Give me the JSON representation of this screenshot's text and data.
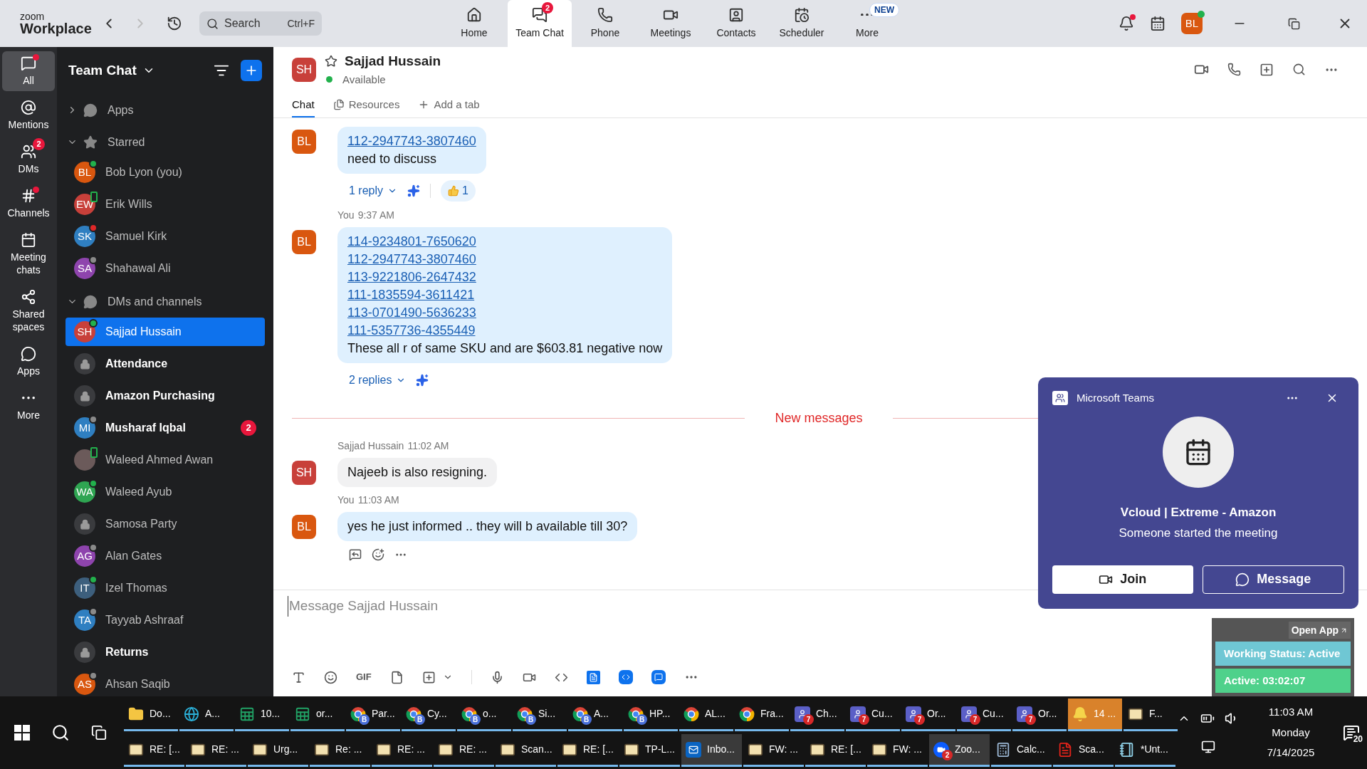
{
  "topbar": {
    "logo_small": "zoom",
    "logo": "Workplace",
    "search": {
      "placeholder": "Search",
      "shortcut": "Ctrl+F"
    },
    "nav": [
      {
        "kind": "home",
        "label": "Home",
        "selected": false
      },
      {
        "kind": "chat",
        "label": "Team Chat",
        "selected": true,
        "badge": "2"
      },
      {
        "kind": "phone",
        "label": "Phone",
        "selected": false
      },
      {
        "kind": "meetings",
        "label": "Meetings",
        "selected": false
      },
      {
        "kind": "contacts",
        "label": "Contacts",
        "selected": false
      },
      {
        "kind": "scheduler",
        "label": "Scheduler",
        "selected": false
      },
      {
        "kind": "more",
        "label": "More",
        "selected": false,
        "tag": "NEW"
      }
    ],
    "avatar": {
      "initials": "BL",
      "color": "#d9570f"
    }
  },
  "rail": [
    {
      "kind": "all",
      "label": "All",
      "selected": true,
      "dot": true
    },
    {
      "kind": "mentions",
      "label": "Mentions",
      "selected": false,
      "dot": false
    },
    {
      "kind": "dms",
      "label": "DMs",
      "selected": false,
      "dot": false,
      "badge": "2"
    },
    {
      "kind": "channels",
      "label": "Channels",
      "selected": false,
      "dot": true
    },
    {
      "kind": "meetings",
      "label": "Meeting chats",
      "selected": false,
      "dot": false
    },
    {
      "kind": "spaces",
      "label": "Shared spaces",
      "selected": false,
      "dot": false
    },
    {
      "kind": "apps",
      "label": "Apps",
      "selected": false,
      "dot": false
    },
    {
      "kind": "more",
      "label": "More",
      "selected": false,
      "dot": false
    }
  ],
  "sidebar": {
    "title": "Team Chat",
    "sections": [
      {
        "kind": "apps",
        "label": "Apps",
        "expanded": false
      },
      {
        "kind": "starred",
        "label": "Starred",
        "expanded": true,
        "items": [
          {
            "kind": "person",
            "initials": "BL",
            "color": "#d9570f",
            "status": {
              "kind": "available"
            },
            "name": "Bob Lyon (you)",
            "unread": false,
            "selected": false
          },
          {
            "kind": "person",
            "initials": "EW",
            "color": "#c8403a",
            "status": {
              "kind": "mobile"
            },
            "name": "Erik Wills",
            "unread": false,
            "selected": false
          },
          {
            "kind": "person",
            "initials": "SK",
            "color": "#2f7fc1",
            "status": {
              "kind": "busy"
            },
            "name": "Samuel Kirk",
            "unread": false,
            "selected": false
          },
          {
            "kind": "person",
            "initials": "SA",
            "color": "#8e44ad",
            "status": {
              "kind": "away"
            },
            "name": "Shahawal Ali",
            "unread": false,
            "selected": false
          }
        ]
      },
      {
        "kind": "dms",
        "label": "DMs and channels",
        "expanded": true,
        "items": [
          {
            "kind": "person",
            "initials": "SH",
            "color": "#c8403a",
            "status": {
              "kind": "available"
            },
            "name": "Sajjad Hussain",
            "unread": false,
            "selected": true
          },
          {
            "kind": "channel",
            "name": "Attendance",
            "unread": true,
            "selected": false
          },
          {
            "kind": "channel",
            "name": "Amazon Purchasing",
            "unread": true,
            "selected": false
          },
          {
            "kind": "person",
            "initials": "MI",
            "color": "#2f7fc1",
            "status": {
              "kind": "away"
            },
            "name": "Musharaf Iqbal",
            "unread": true,
            "selected": false,
            "badge": "2"
          },
          {
            "kind": "photo",
            "status": {
              "kind": "mobile"
            },
            "name": "Waleed Ahmed Awan",
            "unread": false,
            "selected": false
          },
          {
            "kind": "person",
            "initials": "WA",
            "color": "#2fa552",
            "status": {
              "kind": "available"
            },
            "name": "Waleed Ayub",
            "unread": false,
            "selected": false
          },
          {
            "kind": "channel",
            "name": "Samosa Party",
            "unread": false,
            "selected": false
          },
          {
            "kind": "person",
            "initials": "AG",
            "color": "#8e44ad",
            "status": {
              "kind": "away"
            },
            "name": "Alan Gates",
            "unread": false,
            "selected": false
          },
          {
            "kind": "person",
            "initials": "IT",
            "color": "#3d5f7d",
            "status": {
              "kind": "available"
            },
            "name": "Izel Thomas",
            "unread": false,
            "selected": false
          },
          {
            "kind": "person",
            "initials": "TA",
            "color": "#2f7fc1",
            "status": {
              "kind": "away"
            },
            "name": "Tayyab Ashraaf",
            "unread": false,
            "selected": false
          },
          {
            "kind": "channel",
            "name": "Returns",
            "unread": true,
            "selected": false
          },
          {
            "kind": "person",
            "initials": "AS",
            "color": "#d9570f",
            "status": {
              "kind": "away"
            },
            "name": "Ahsan Saqib",
            "unread": false,
            "selected": false
          }
        ]
      }
    ]
  },
  "chat": {
    "avatar": {
      "initials": "SH",
      "color": "#c8403a"
    },
    "name": "Sajjad Hussain",
    "presence": "Available",
    "tabs": [
      {
        "kind": "chat",
        "label": "Chat",
        "selected": true
      },
      {
        "kind": "resources",
        "label": "Resources",
        "selected": false
      },
      {
        "kind": "add",
        "label": "Add a tab",
        "selected": false
      }
    ],
    "messages": [
      {
        "kind": "message",
        "from": {
          "kind": "self"
        },
        "initials": "BL",
        "color": "#d9570f",
        "links": [
          "112-2947743-3807460"
        ],
        "text": "need to discuss",
        "replies": "1 reply",
        "reaction": {
          "count": "1"
        }
      },
      {
        "kind": "message",
        "from": {
          "kind": "self"
        },
        "sender": "You",
        "time": "9:37 AM",
        "initials": "BL",
        "color": "#d9570f",
        "links": [
          "114-9234801-7650620",
          "112-2947743-3807460",
          "113-9221806-2647432",
          "111-1835594-3611421",
          "113-0701490-5636233",
          "111-5357736-4355449"
        ],
        "text": "These all r of same SKU and are $603.81 negative now",
        "replies": "2 replies"
      },
      {
        "kind": "divider",
        "label": "New messages"
      },
      {
        "kind": "message",
        "from": {
          "kind": "other"
        },
        "sender": "Sajjad Hussain",
        "time": "11:02 AM",
        "initials": "SH",
        "color": "#c8403a",
        "text": "Najeeb is also resigning."
      },
      {
        "kind": "message",
        "from": {
          "kind": "self"
        },
        "sender": "You",
        "time": "11:03 AM",
        "initials": "BL",
        "color": "#d9570f",
        "text": "yes he just informed .. they will b available till 30?",
        "hovered": true
      }
    ],
    "composer": {
      "placeholder": "Message Sajjad Hussain",
      "gif": "GIF"
    }
  },
  "popup": {
    "app": "Microsoft Teams",
    "title": "Vcloud | Extreme - Amazon",
    "subtitle": "Someone started the meeting",
    "buttons": [
      {
        "kind": "primary",
        "label": "Join"
      },
      {
        "kind": "outline",
        "label": "Message"
      }
    ]
  },
  "widget": {
    "open_app": "Open App",
    "status": "Working Status: Active",
    "timer": "Active: 03:02:07"
  },
  "taskbar": {
    "row_1": [
      {
        "kind": "folder",
        "label": "Do...",
        "flashing": false
      },
      {
        "kind": "edge",
        "label": "A...",
        "flashing": false
      },
      {
        "kind": "excel",
        "label": "10...",
        "flashing": false
      },
      {
        "kind": "excel",
        "label": "or...",
        "flashing": false
      },
      {
        "kind": "chrome",
        "badge": "B",
        "label": "Par...",
        "flashing": false
      },
      {
        "kind": "chrome",
        "badge": "B",
        "label": "Cy...",
        "flashing": false
      },
      {
        "kind": "chrome",
        "badge": "B",
        "label": "o...",
        "flashing": false
      },
      {
        "kind": "chrome",
        "badge": "B",
        "label": "Si...",
        "flashing": false
      },
      {
        "kind": "chrome",
        "badge": "B",
        "label": "A...",
        "flashing": false
      },
      {
        "kind": "chrome",
        "badge": "B",
        "label": "HP...",
        "flashing": false
      },
      {
        "kind": "chrome",
        "label": "AL...",
        "flashing": false
      },
      {
        "kind": "chrome",
        "label": "Fra...",
        "flashing": false
      },
      {
        "kind": "teams",
        "badge": "7",
        "label": "Ch...",
        "flashing": false
      },
      {
        "kind": "teams",
        "badge": "7",
        "label": "Cu...",
        "flashing": false
      },
      {
        "kind": "teams",
        "badge": "7",
        "label": "Or...",
        "flashing": false
      },
      {
        "kind": "teams",
        "badge": "7",
        "label": "Cu...",
        "flashing": false
      },
      {
        "kind": "teams",
        "badge": "7",
        "label": "Or...",
        "flashing": false
      },
      {
        "kind": "bell",
        "label": "14 ...",
        "flashing": true
      },
      {
        "kind": "mail",
        "label": "F...",
        "flashing": false
      }
    ],
    "row_2": [
      {
        "kind": "mail",
        "label": "RE: [...",
        "active": false
      },
      {
        "kind": "mail",
        "label": "RE: ...",
        "active": false
      },
      {
        "kind": "mail",
        "label": "Urg...",
        "active": false
      },
      {
        "kind": "mail",
        "label": "Re: ...",
        "active": false
      },
      {
        "kind": "mail",
        "label": "RE: ...",
        "active": false
      },
      {
        "kind": "mail",
        "label": "RE: ...",
        "active": false
      },
      {
        "kind": "mail",
        "label": "Scan...",
        "active": false
      },
      {
        "kind": "mail",
        "label": "RE: [...",
        "active": false
      },
      {
        "kind": "mail",
        "label": "TP-L...",
        "active": false
      },
      {
        "kind": "outlook",
        "label": "Inbo...",
        "active": true
      },
      {
        "kind": "mail",
        "label": "FW: ...",
        "active": false
      },
      {
        "kind": "mail",
        "label": "RE: [...",
        "active": false
      },
      {
        "kind": "mail",
        "label": "FW: ...",
        "active": false
      },
      {
        "kind": "zoom",
        "badge": "2",
        "label": "Zoo...",
        "active": true
      },
      {
        "kind": "calc",
        "label": "Calc...",
        "active": false
      },
      {
        "kind": "pdf",
        "label": "Sca...",
        "active": false
      },
      {
        "kind": "notepad",
        "label": "*Unt...",
        "active": false
      }
    ],
    "clock": {
      "time": "11:03 AM",
      "day": "Monday",
      "date": "7/14/2025"
    },
    "notifications": "20"
  }
}
